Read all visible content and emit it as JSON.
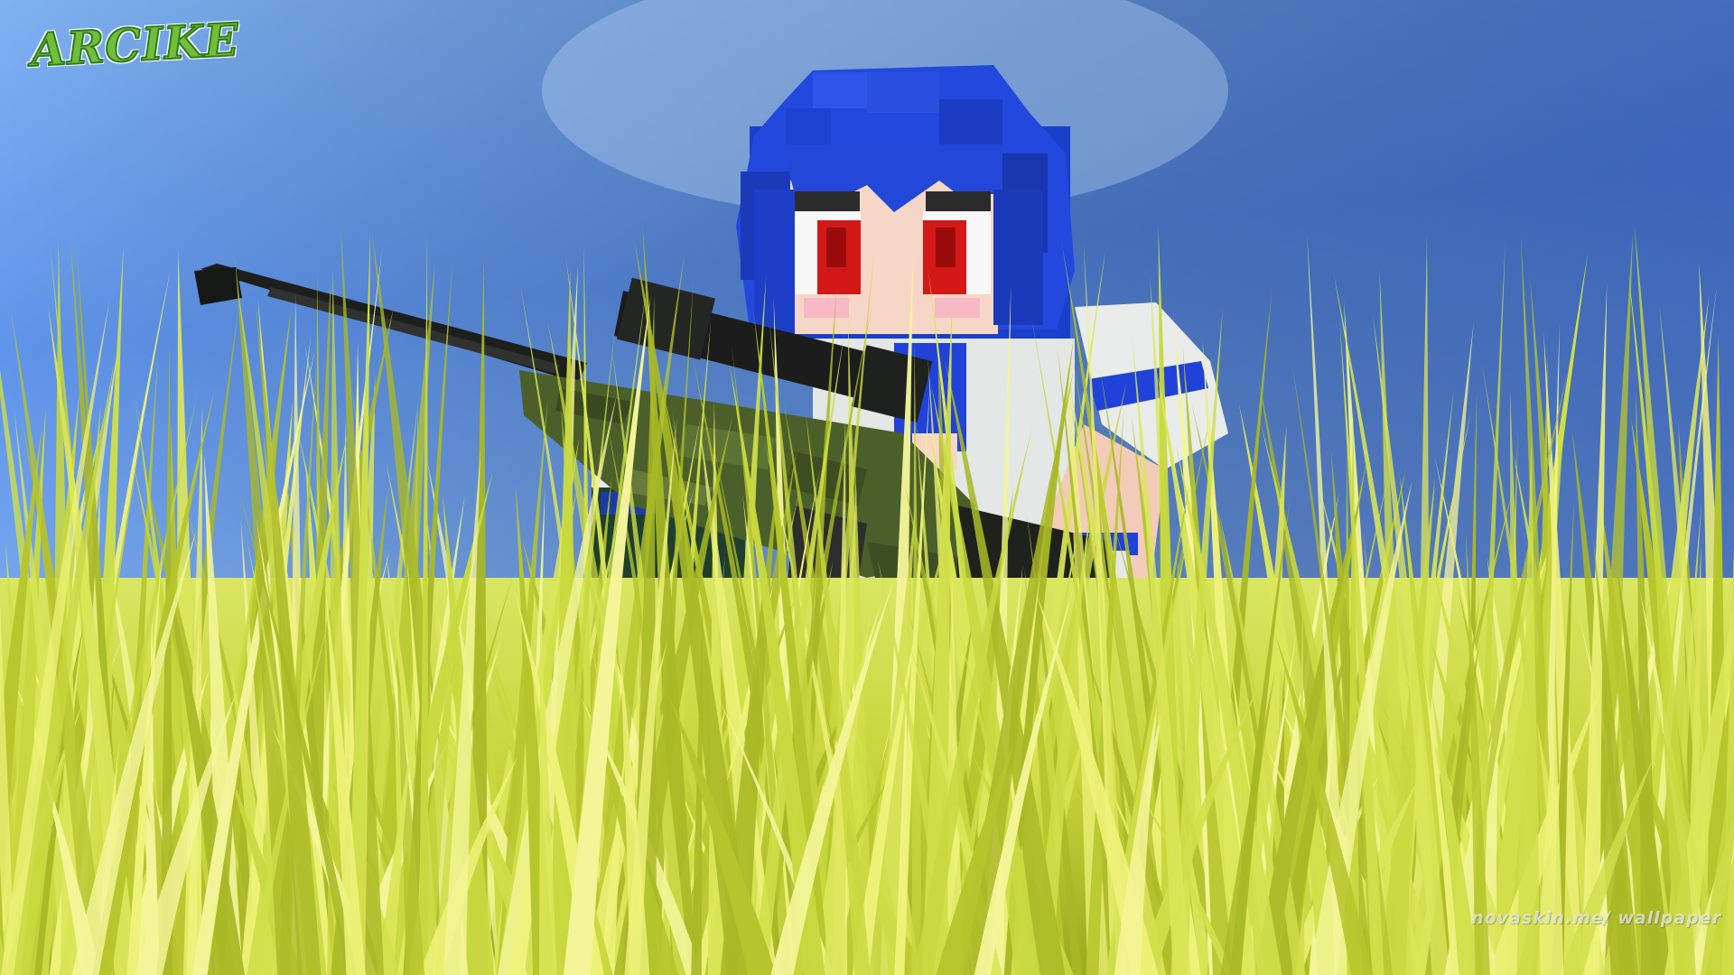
{
  "scene": {
    "subject": "minecraft-skin-sniper-in-grass",
    "colors": {
      "sky_top": "#3f6fd0",
      "sky_bottom": "#8fc0f5",
      "hair": "#1f45d8",
      "hair_dark": "#1736b0",
      "skin": "#f6d7c7",
      "eye_red": "#d31818",
      "shirt_white": "#e9ecea",
      "shirt_blue": "#2142d9",
      "rifle_dark": "#1d1f1d",
      "rifle_camo": "#4b5f2a",
      "grass_light": "#e7f06a",
      "grass_dark": "#8a9a1e"
    }
  },
  "branding": {
    "logo_text": "ARCIKE",
    "watermark_text": "novaskin.me/ wallpaper"
  }
}
